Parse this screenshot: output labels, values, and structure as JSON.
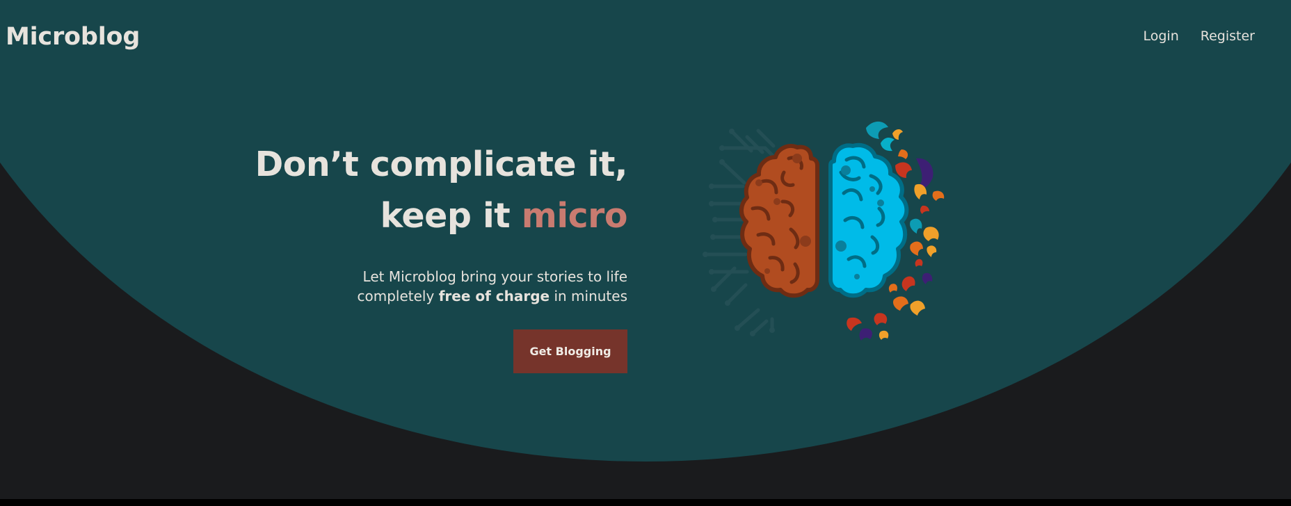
{
  "brand": {
    "name": "Microblog"
  },
  "nav": {
    "items": [
      {
        "label": "Login"
      },
      {
        "label": "Register"
      }
    ]
  },
  "hero": {
    "headline_line1": "Don’t complicate it,",
    "headline_line2_prefix": "keep it ",
    "headline_line2_accent": "micro",
    "subtext_line1": "Let Microblog bring your stories to life",
    "subtext_line2_prefix": "completely ",
    "subtext_line2_bold": "free of charge",
    "subtext_line2_suffix": " in minutes",
    "cta_label": "Get Blogging"
  },
  "colors": {
    "hero_background": "#17464b",
    "page_background": "#1a1b1d",
    "accent_text": "#c97b70",
    "cta_background": "#76342b",
    "brain_left": "#b14c20",
    "brain_right": "#00bbe8"
  },
  "icons": {
    "illustration": "brain-illustration-icon"
  }
}
